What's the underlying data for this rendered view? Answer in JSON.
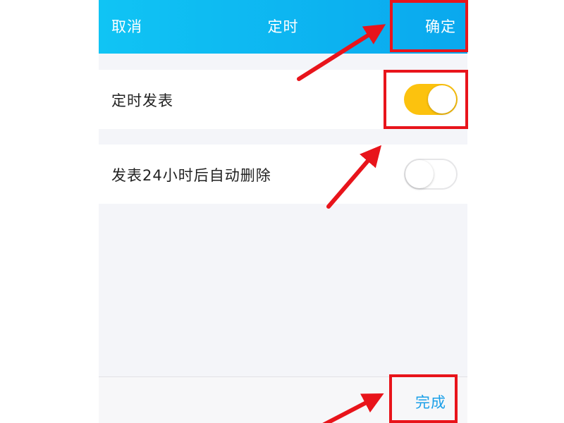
{
  "nav": {
    "cancel_label": "取消",
    "title": "定时",
    "confirm_label": "确定"
  },
  "settings": [
    {
      "label": "定时发表",
      "enabled": true
    },
    {
      "label": "发表24小时后自动删除",
      "enabled": false
    }
  ],
  "bottom_bar": {
    "done_label": "完成"
  },
  "colors": {
    "nav_gradient_start": "#10c4f4",
    "nav_gradient_end": "#0aa8ee",
    "toggle_on": "#fcc20e",
    "done_text": "#1a9fe8",
    "annotation_red": "#e8141b",
    "background": "#f4f5f9"
  }
}
